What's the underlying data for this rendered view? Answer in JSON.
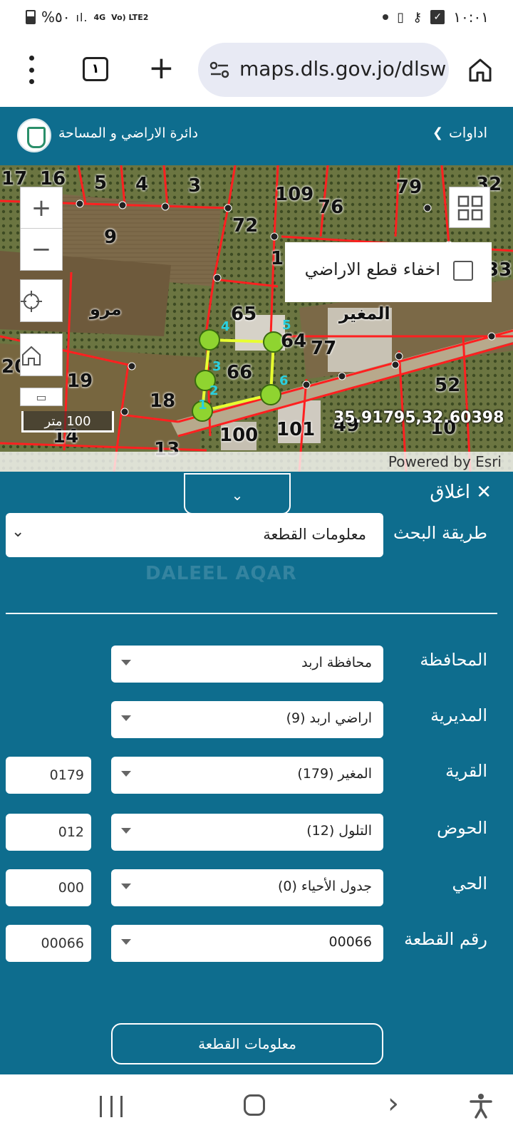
{
  "status_bar": {
    "battery": "%٥٠",
    "network_left": "4G",
    "network_right": "Vo) LTE2",
    "time": "١٠:٠١"
  },
  "browser": {
    "tab_count": "١",
    "url": "maps.dls.gov.jo/dlsw"
  },
  "header": {
    "dept_name": "دائرة الاراضي و المساحة",
    "tools_label": "اداوات"
  },
  "map": {
    "hide_parcels_label": "اخفاء قطع الاراضي",
    "scale_label": "100 متر",
    "coordinates": "35.91795,32.60398",
    "attribution": "Powered by Esri",
    "parcel_labels": [
      {
        "text": "17"
      },
      {
        "text": "16"
      },
      {
        "text": "5"
      },
      {
        "text": "4"
      },
      {
        "text": "3"
      },
      {
        "text": "109"
      },
      {
        "text": "76"
      },
      {
        "text": "79"
      },
      {
        "text": "32"
      },
      {
        "text": "72"
      },
      {
        "text": "9"
      },
      {
        "text": "1"
      },
      {
        "text": "33"
      },
      {
        "text": "مرو"
      },
      {
        "text": "65"
      },
      {
        "text": "المغير"
      },
      {
        "text": "64"
      },
      {
        "text": "77"
      },
      {
        "text": "20"
      },
      {
        "text": "66"
      },
      {
        "text": "19"
      },
      {
        "text": "52"
      },
      {
        "text": "18"
      },
      {
        "text": "14"
      },
      {
        "text": "100"
      },
      {
        "text": "101"
      },
      {
        "text": "49"
      },
      {
        "text": "10"
      },
      {
        "text": "13"
      }
    ],
    "vertex_labels": [
      "1",
      "2",
      "3",
      "4",
      "5",
      "6"
    ],
    "accent_color": "#e8ff30",
    "boundary_color": "#ff2020"
  },
  "panel": {
    "close_label": "اغلاق",
    "search_method_label": "طريقة البحث",
    "search_method_value": "معلومات القطعة",
    "watermark": "DALEEL AQAR",
    "fields": [
      {
        "label": "المحافظة",
        "value": "محافظة اربد",
        "code": ""
      },
      {
        "label": "المديرية",
        "value": "اراضي اربد (9)",
        "code": ""
      },
      {
        "label": "القرية",
        "value": "المغير (179)",
        "code": "0179"
      },
      {
        "label": "الحوض",
        "value": "التلول (12)",
        "code": "012"
      },
      {
        "label": "الحي",
        "value": "جدول الأحياء (0)",
        "code": "000"
      },
      {
        "label": "رقم القطعة",
        "value": "00066",
        "code": "00066"
      }
    ],
    "submit_label": "معلومات القطعة",
    "background_color": "#0e6d8e"
  }
}
